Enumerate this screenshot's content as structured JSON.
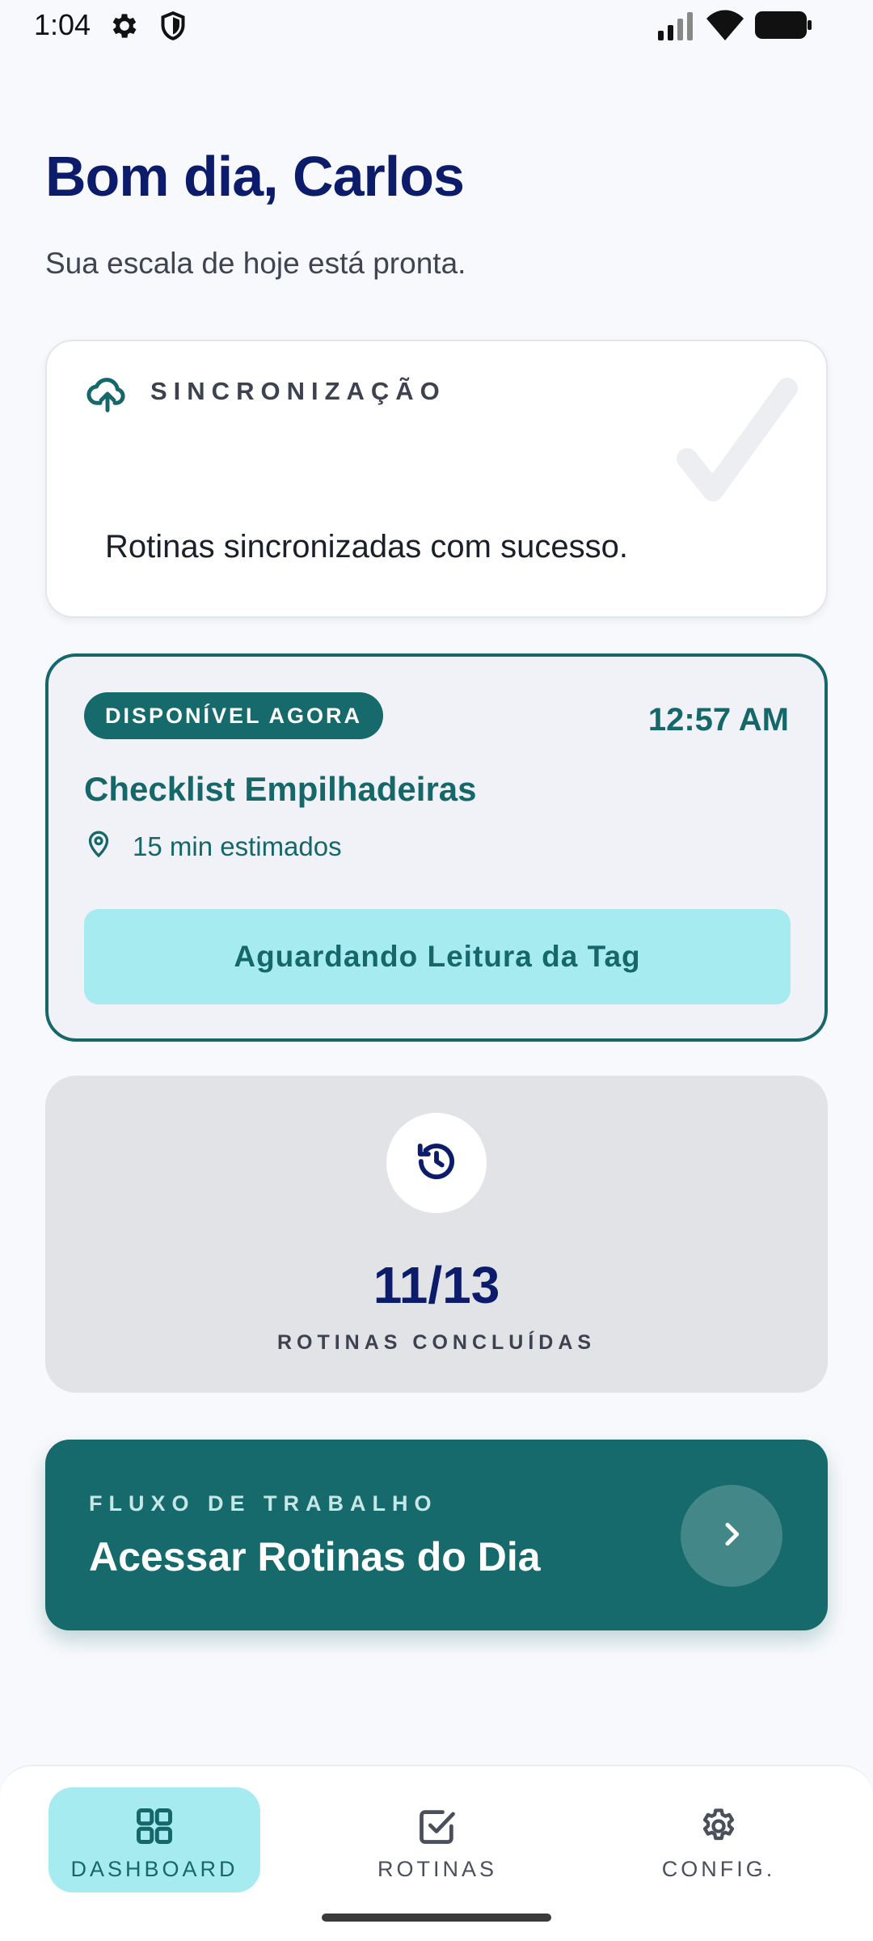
{
  "status_bar": {
    "time": "1:04",
    "icons": [
      "gear-icon",
      "shield-icon",
      "signal-icon",
      "wifi-icon",
      "battery-icon"
    ]
  },
  "header": {
    "greeting": "Bom dia, Carlos",
    "subtitle": "Sua escala de hoje está pronta."
  },
  "sync_card": {
    "icon": "cloud-upload-icon",
    "label": "SINCRONIZAÇÃO",
    "message": "Rotinas sincronizadas com sucesso."
  },
  "routine_card": {
    "badge": "DISPONÍVEL AGORA",
    "time": "12:57 AM",
    "title": "Checklist Empilhadeiras",
    "estimate": "15 min estimados",
    "button_label": "Aguardando Leitura da Tag"
  },
  "progress_card": {
    "icon": "history-icon",
    "count": "11/13",
    "label": "ROTINAS CONCLUÍDAS"
  },
  "workflow_card": {
    "label": "FLUXO DE TRABALHO",
    "title": "Acessar Rotinas do Dia",
    "icon": "chevron-right-icon"
  },
  "bottom_nav": {
    "items": [
      {
        "label": "DASHBOARD",
        "icon": "grid-icon",
        "active": true
      },
      {
        "label": "ROTINAS",
        "icon": "checkbox-icon",
        "active": false
      },
      {
        "label": "CONFIG.",
        "icon": "gear-icon",
        "active": false
      }
    ]
  },
  "colors": {
    "primary": "#166a6b",
    "navy": "#0d1b6b",
    "accent_light": "#a6ebef",
    "background": "#f8f9fc"
  }
}
